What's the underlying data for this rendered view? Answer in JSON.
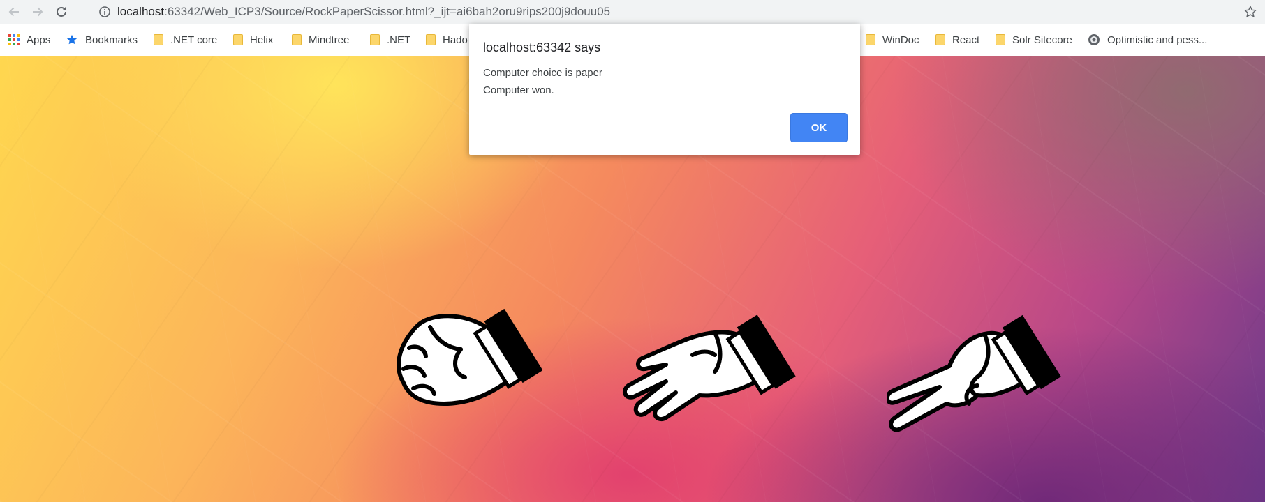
{
  "browser": {
    "url_host": "localhost",
    "url_path": ":63342/Web_ICP3/Source/RockPaperScissor.html?_ijt=ai6bah2oru9rips200j9douu05",
    "icons": [
      "back-arrow-icon",
      "forward-arrow-icon",
      "reload-icon",
      "info-icon",
      "star-icon"
    ]
  },
  "bookmarks": [
    {
      "label": "Apps",
      "icon": "apps-grid-icon"
    },
    {
      "label": "Bookmarks",
      "icon": "star-icon"
    },
    {
      "label": ".NET core",
      "icon": "folder-icon"
    },
    {
      "label": "Helix",
      "icon": "folder-icon"
    },
    {
      "label": "Mindtree",
      "icon": "folder-icon"
    },
    {
      "label": ".NET",
      "icon": "folder-icon"
    },
    {
      "label": "Hado",
      "icon": "folder-icon"
    },
    {
      "label": "WinDoc",
      "icon": "folder-icon"
    },
    {
      "label": "React",
      "icon": "folder-icon"
    },
    {
      "label": "Solr Sitecore",
      "icon": "folder-icon"
    },
    {
      "label": "Optimistic and pess...",
      "icon": "globe-icon"
    }
  ],
  "dialog": {
    "title": "localhost:63342 says",
    "line1": "Computer choice is paper",
    "line2": "Computer won.",
    "ok_label": "OK"
  },
  "game": {
    "choices": [
      "rock",
      "paper",
      "scissors"
    ]
  }
}
